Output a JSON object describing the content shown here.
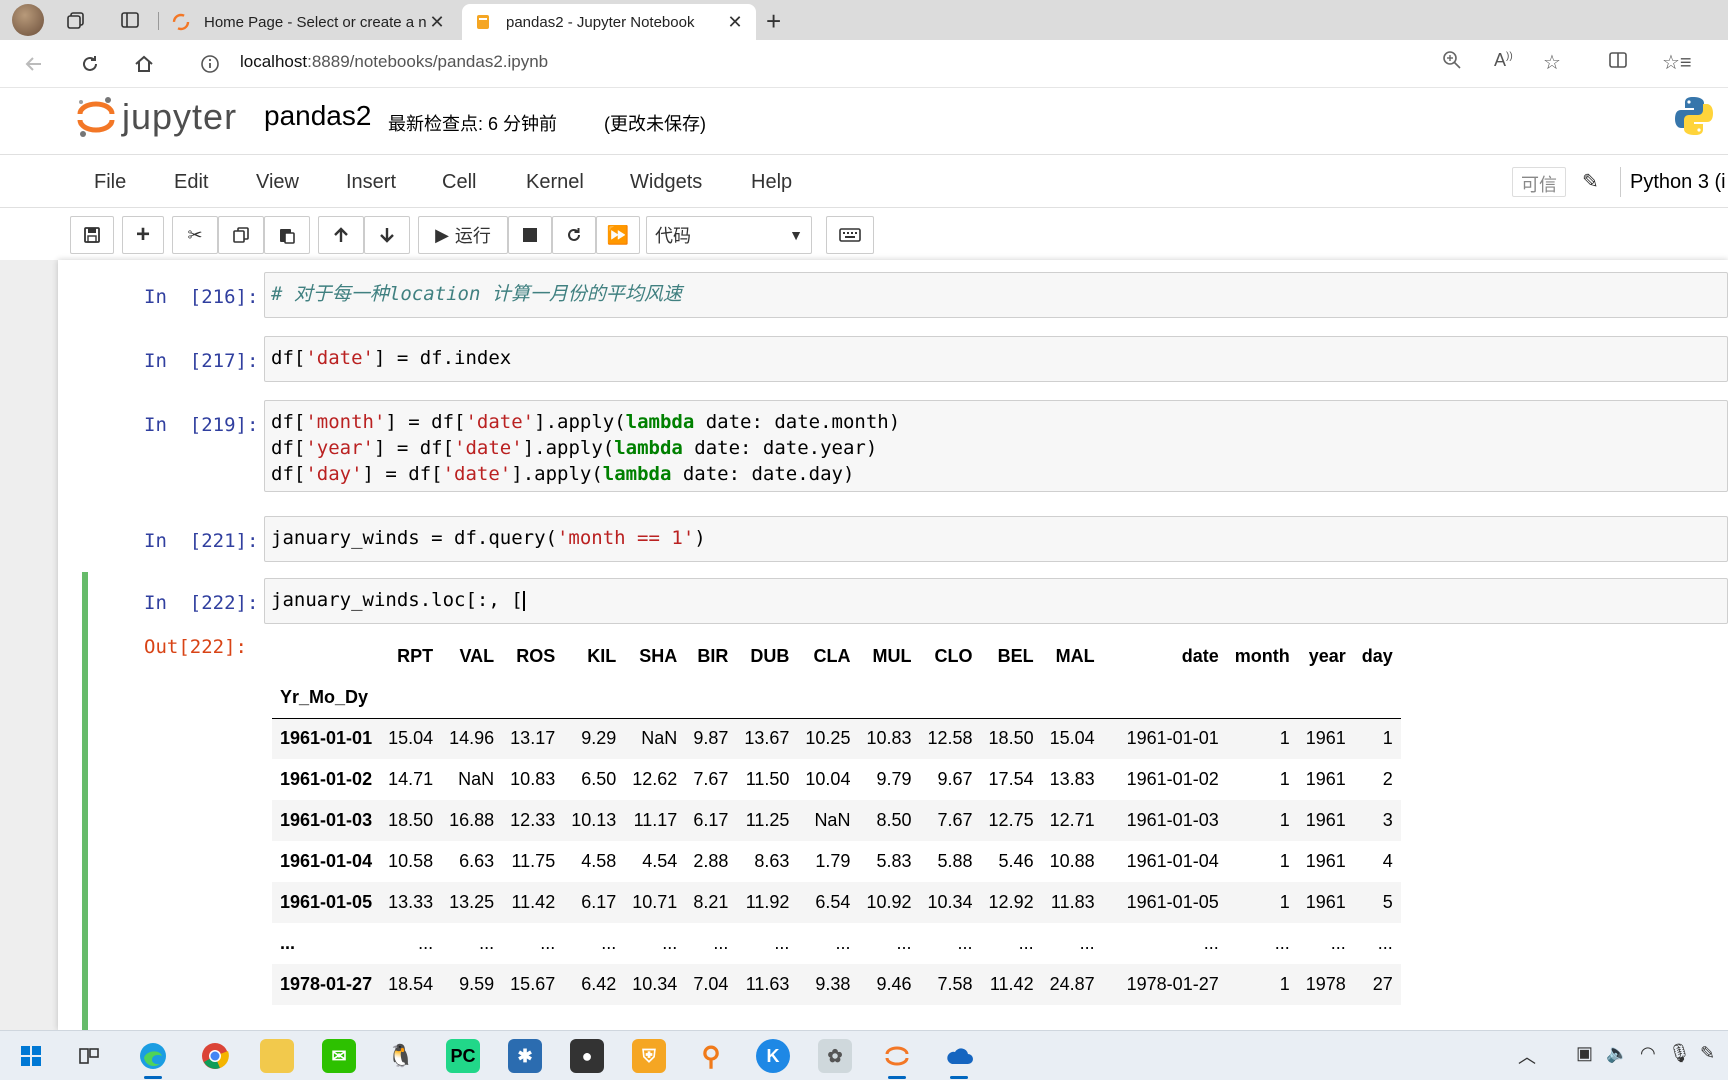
{
  "browser": {
    "tabs": [
      {
        "label": "Home Page - Select or create a n",
        "close": "✕"
      },
      {
        "label": "pandas2 - Jupyter Notebook",
        "close": "✕"
      }
    ],
    "new_tab": "+",
    "url_host": "localhost",
    "url_path": ":8889/notebooks/pandas2.ipynb"
  },
  "jupyter": {
    "logo_text": "jupyter",
    "notebook_name": "pandas2",
    "checkpoint": "最新检查点: 6 分钟前",
    "unsaved": "(更改未保存)",
    "menu": [
      "File",
      "Edit",
      "View",
      "Insert",
      "Cell",
      "Kernel",
      "Widgets",
      "Help"
    ],
    "trusted": "可信",
    "kernel": "Python 3 (i",
    "run_label": "运行",
    "cell_type": "代码"
  },
  "cells": [
    {
      "prompt": "In  [216]:",
      "code": "# 对于每一种location 计算一月份的平均风速"
    },
    {
      "prompt": "In  [217]:",
      "code_a": "df[",
      "code_s1": "'date'",
      "code_b": "] = df.index"
    },
    {
      "prompt": "In  [219]:",
      "lines": [
        {
          "a": "df[",
          "s1": "'month'",
          "b": "] = df[",
          "s2": "'date'",
          "c": "].apply(",
          "kw": "lambda",
          "d": " date: date.month)"
        },
        {
          "a": "df[",
          "s1": "'year'",
          "b": "] = df[",
          "s2": "'date'",
          "c": "].apply(",
          "kw": "lambda",
          "d": " date: date.year)"
        },
        {
          "a": "df[",
          "s1": "'day'",
          "b": "] = df[",
          "s2": "'date'",
          "c": "].apply(",
          "kw": "lambda",
          "d": " date: date.day)"
        }
      ]
    },
    {
      "prompt": "In  [221]:",
      "code_a": "january_winds = df.query(",
      "code_s1": "'month == 1'",
      "code_b": ")"
    },
    {
      "prompt": "In  [222]:",
      "code_a": "january_winds.loc",
      "code_b": "[:, [",
      "out_prompt": "Out[222]:"
    }
  ],
  "dataframe": {
    "columns": [
      "RPT",
      "VAL",
      "ROS",
      "KIL",
      "SHA",
      "BIR",
      "DUB",
      "CLA",
      "MUL",
      "CLO",
      "BEL",
      "MAL",
      "date",
      "month",
      "year",
      "day"
    ],
    "index_name": "Yr_Mo_Dy",
    "rows": [
      {
        "index": "1961-01-01",
        "values": [
          "15.04",
          "14.96",
          "13.17",
          "9.29",
          "NaN",
          "9.87",
          "13.67",
          "10.25",
          "10.83",
          "12.58",
          "18.50",
          "15.04",
          "1961-01-01",
          "1",
          "1961",
          "1"
        ]
      },
      {
        "index": "1961-01-02",
        "values": [
          "14.71",
          "NaN",
          "10.83",
          "6.50",
          "12.62",
          "7.67",
          "11.50",
          "10.04",
          "9.79",
          "9.67",
          "17.54",
          "13.83",
          "1961-01-02",
          "1",
          "1961",
          "2"
        ]
      },
      {
        "index": "1961-01-03",
        "values": [
          "18.50",
          "16.88",
          "12.33",
          "10.13",
          "11.17",
          "6.17",
          "11.25",
          "NaN",
          "8.50",
          "7.67",
          "12.75",
          "12.71",
          "1961-01-03",
          "1",
          "1961",
          "3"
        ]
      },
      {
        "index": "1961-01-04",
        "values": [
          "10.58",
          "6.63",
          "11.75",
          "4.58",
          "4.54",
          "2.88",
          "8.63",
          "1.79",
          "5.83",
          "5.88",
          "5.46",
          "10.88",
          "1961-01-04",
          "1",
          "1961",
          "4"
        ]
      },
      {
        "index": "1961-01-05",
        "values": [
          "13.33",
          "13.25",
          "11.42",
          "6.17",
          "10.71",
          "8.21",
          "11.92",
          "6.54",
          "10.92",
          "10.34",
          "12.92",
          "11.83",
          "1961-01-05",
          "1",
          "1961",
          "5"
        ]
      },
      {
        "index": "...",
        "values": [
          "...",
          "...",
          "...",
          "...",
          "...",
          "...",
          "...",
          "...",
          "...",
          "...",
          "...",
          "...",
          "...",
          "...",
          "...",
          "..."
        ]
      },
      {
        "index": "1978-01-27",
        "values": [
          "18.54",
          "9.59",
          "15.67",
          "6.42",
          "10.34",
          "7.04",
          "11.63",
          "9.38",
          "9.46",
          "7.58",
          "11.42",
          "24.87",
          "1978-01-27",
          "1",
          "1978",
          "27"
        ]
      }
    ]
  },
  "colors": {
    "prompt_in": "#303f9f",
    "prompt_out": "#d84315",
    "selected_bar": "#66bb6a",
    "string": "#ba2121",
    "keyword": "#008000",
    "comment": "#408080"
  }
}
